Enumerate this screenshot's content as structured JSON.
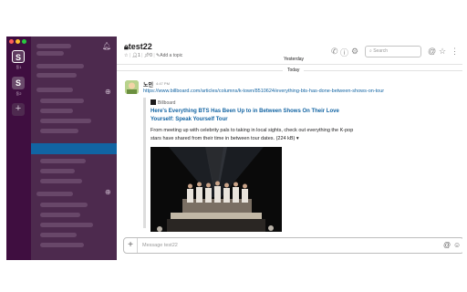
{
  "window": {
    "traffic_colors": [
      "#ff5f57",
      "#febc2e",
      "#28c840"
    ]
  },
  "rail": {
    "workspaces": [
      {
        "initial": "S",
        "label": "동1"
      },
      {
        "initial": "S",
        "label": "동2"
      }
    ],
    "add_label": "+"
  },
  "sidebar": {
    "bell_icon": "bell-icon",
    "active_color": "#1164a3"
  },
  "header": {
    "channel": "test22",
    "star": "☆",
    "members": "1",
    "pins": "0",
    "add_topic": "Add a topic",
    "search_placeholder": "Search"
  },
  "messages": {
    "yesterday": "Yesterday",
    "today": "Today",
    "sender": "노인",
    "time": "4:47 PM",
    "link": "https://www.billboard.com/articles/columns/k-town/8510624/everything-bts-has-done-between-shows-on-tour",
    "unfurl": {
      "site": "Billboard",
      "title": "Here's Everything BTS Has Been Up to in Between Shows On Their Love Yourself: Speak Yourself Tour",
      "description": "From meeting up with celebrity pals to taking in local sights, check out everything the K-pop stars have shared from their time in between tour dates.",
      "size": "(224 kB)",
      "caret": "▾"
    }
  },
  "composer": {
    "placeholder": "Message test22",
    "plus": "+",
    "mention": "@",
    "emoji": "☺"
  }
}
